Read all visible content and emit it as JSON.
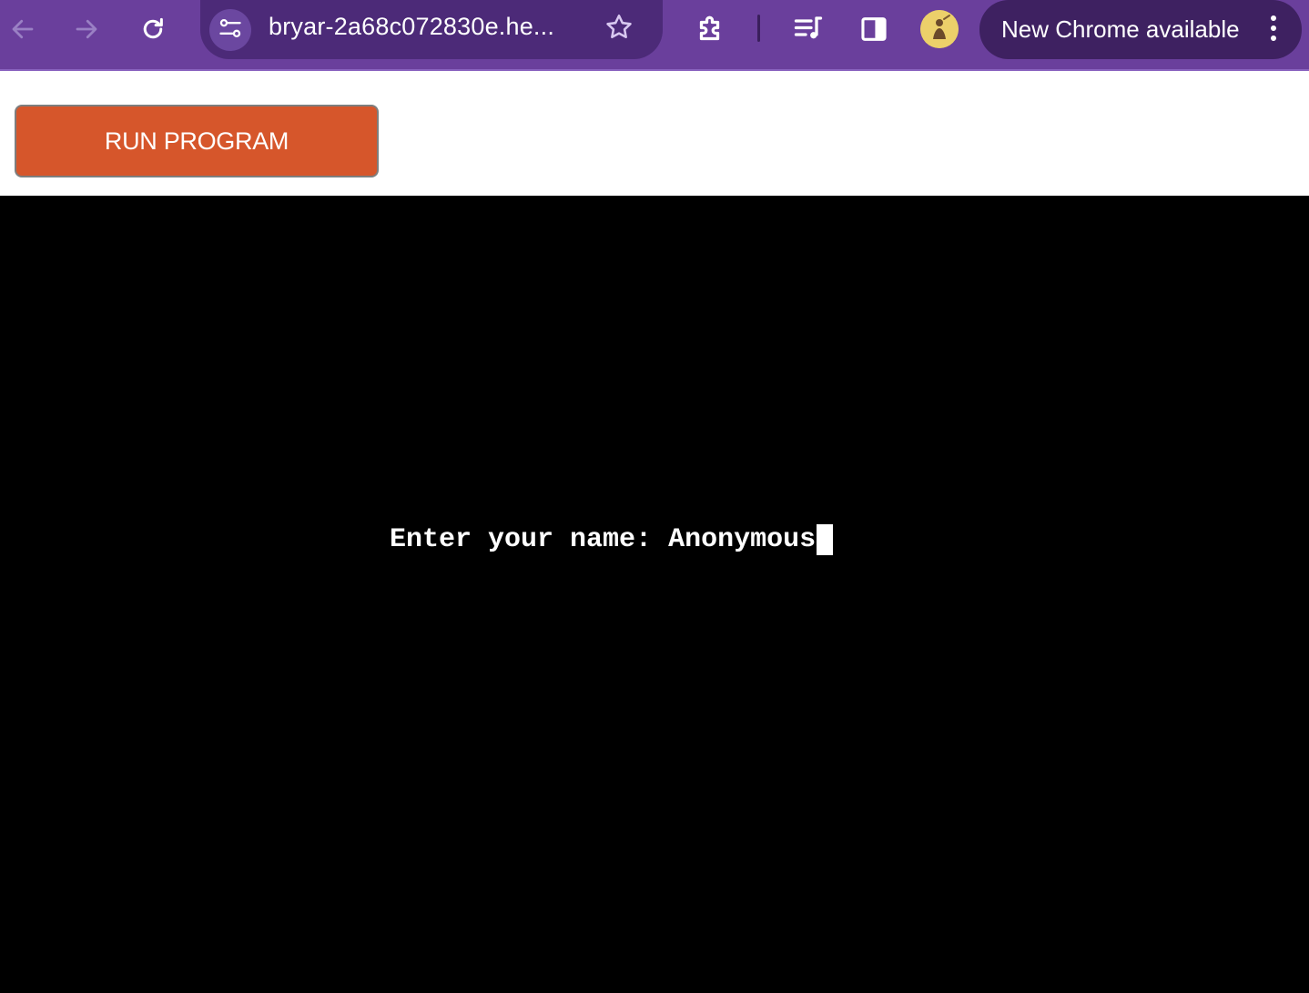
{
  "browser": {
    "url": "bryar-2a68c072830e.he...",
    "update_label": "New Chrome available",
    "icons": {
      "back": "arrow-left-icon",
      "forward": "arrow-right-icon",
      "reload": "reload-icon",
      "site_info": "tune-icon",
      "bookmark": "star-icon",
      "extensions": "puzzle-icon",
      "media": "queue-music-icon",
      "side_panel": "side-panel-icon",
      "profile": "avatar",
      "menu": "kebab-icon"
    },
    "colors": {
      "toolbar": "#6a3f9c",
      "omnibox": "#4c2a78",
      "update_chip": "#3e2161"
    }
  },
  "page": {
    "run_button_label": "RUN PROGRAM",
    "run_button_color": "#d6562b",
    "terminal": {
      "prompt": "Enter your name: ",
      "input_value": "Anonymous",
      "background": "#000000",
      "foreground": "#ffffff"
    }
  }
}
